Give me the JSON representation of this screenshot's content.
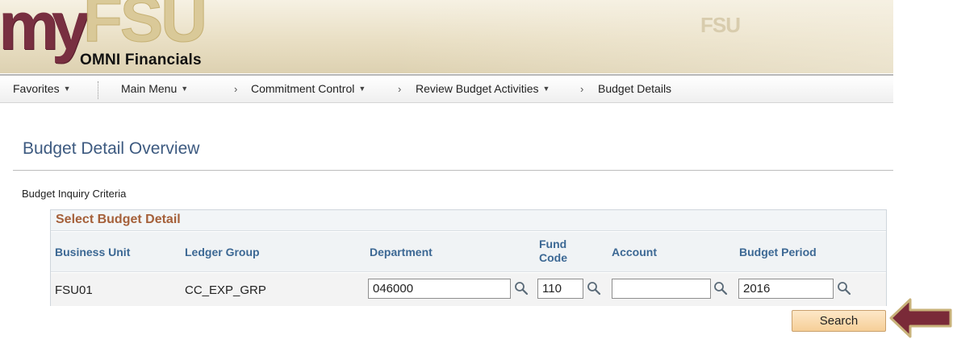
{
  "header": {
    "logo_my": "my",
    "logo_fsu": "FSU",
    "app_name": "OMNI Financials"
  },
  "nav": {
    "favorites": "Favorites",
    "main_menu": "Main Menu",
    "crumbs": [
      "Commitment Control",
      "Review Budget Activities",
      "Budget Details"
    ]
  },
  "page": {
    "title": "Budget Detail Overview",
    "criteria_label": "Budget Inquiry Criteria"
  },
  "grid": {
    "caption": "Select Budget Detail",
    "columns": {
      "business_unit": "Business Unit",
      "ledger_group": "Ledger Group",
      "department": "Department",
      "fund_code_1": "Fund",
      "fund_code_2": "Code",
      "account": "Account",
      "budget_period": "Budget Period"
    },
    "row": {
      "business_unit": "FSU01",
      "ledger_group": "CC_EXP_GRP",
      "department": "046000",
      "fund_code": "110",
      "account": "",
      "budget_period": "2016"
    }
  },
  "actions": {
    "search_label": "Search"
  },
  "colors": {
    "garnet": "#782f40",
    "gold": "#d9c896",
    "title_blue": "#3d5a80",
    "header_blue": "#3c6894",
    "caption_brown": "#a5603a"
  },
  "icons": {
    "lookup": "magnifier-icon",
    "dropdown": "caret-down-icon",
    "pointer": "arrow-left-icon"
  }
}
